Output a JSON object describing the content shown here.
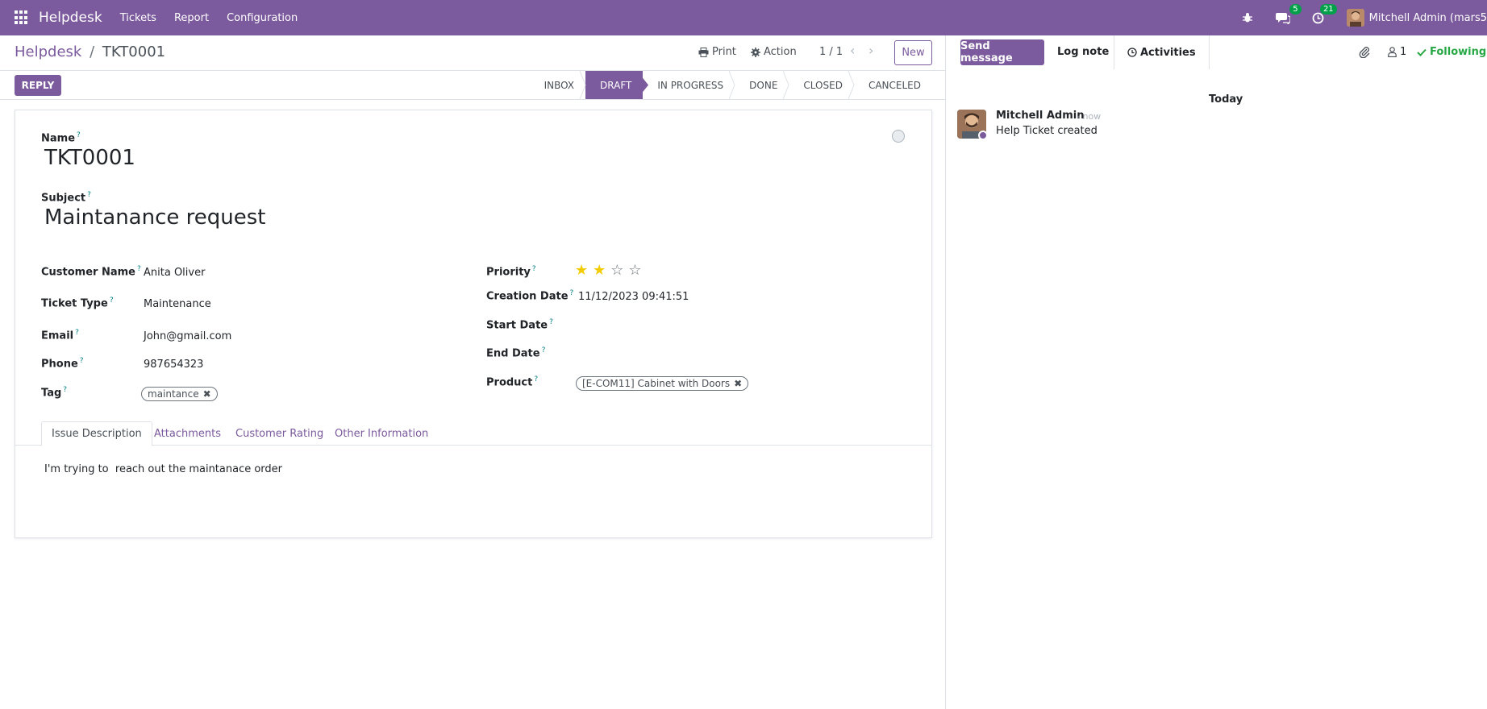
{
  "navbar": {
    "brand": "Helpdesk",
    "menu": [
      "Tickets",
      "Report",
      "Configuration"
    ],
    "messages_count": "5",
    "activities_count": "21",
    "user_name": "Mitchell Admin (mars5"
  },
  "control_panel": {
    "breadcrumb_parent": "Helpdesk",
    "breadcrumb_sep": "/",
    "breadcrumb_current": "TKT0001",
    "print_label": "Print",
    "action_label": "Action",
    "pager": "1 / 1",
    "new_label": "New"
  },
  "statusbar": {
    "reply_label": "REPLY",
    "stages": [
      "INBOX",
      "DRAFT",
      "IN PROGRESS",
      "DONE",
      "CLOSED",
      "CANCELED"
    ],
    "active_stage": "DRAFT"
  },
  "form": {
    "name_label": "Name",
    "name_value": "TKT0001",
    "subject_label": "Subject",
    "subject_value": "Maintanance request",
    "customer_name_label": "Customer Name",
    "customer_name_value": "Anita Oliver",
    "ticket_type_label": "Ticket Type",
    "ticket_type_value": "Maintenance",
    "email_label": "Email",
    "email_value": "John@gmail.com",
    "phone_label": "Phone",
    "phone_value": "987654323",
    "tag_label": "Tag",
    "tag_value": "maintance",
    "priority_label": "Priority",
    "priority_value": 2,
    "priority_max": 4,
    "creation_date_label": "Creation Date",
    "creation_date_value": "11/12/2023 09:41:51",
    "start_date_label": "Start Date",
    "end_date_label": "End Date",
    "product_label": "Product",
    "product_value": "[E-COM11] Cabinet with Doors",
    "help_mark": "?"
  },
  "tabs": {
    "items": [
      "Issue Description",
      "Attachments",
      "Customer Rating",
      "Other Information"
    ],
    "active": "Issue Description",
    "description": "I'm trying to  reach out the maintanace order"
  },
  "chatter": {
    "send_message_label": "Send message",
    "log_note_label": "Log note",
    "activities_label": "Activities",
    "followers_count": "1",
    "following_label": "Following",
    "today_label": "Today",
    "message": {
      "author": "Mitchell Admin",
      "time": "- now",
      "body": "Help Ticket created"
    }
  },
  "colors": {
    "brand": "#7c5a9e",
    "badge": "#00a04a",
    "star": "#f3cc00",
    "following": "#28a745"
  }
}
